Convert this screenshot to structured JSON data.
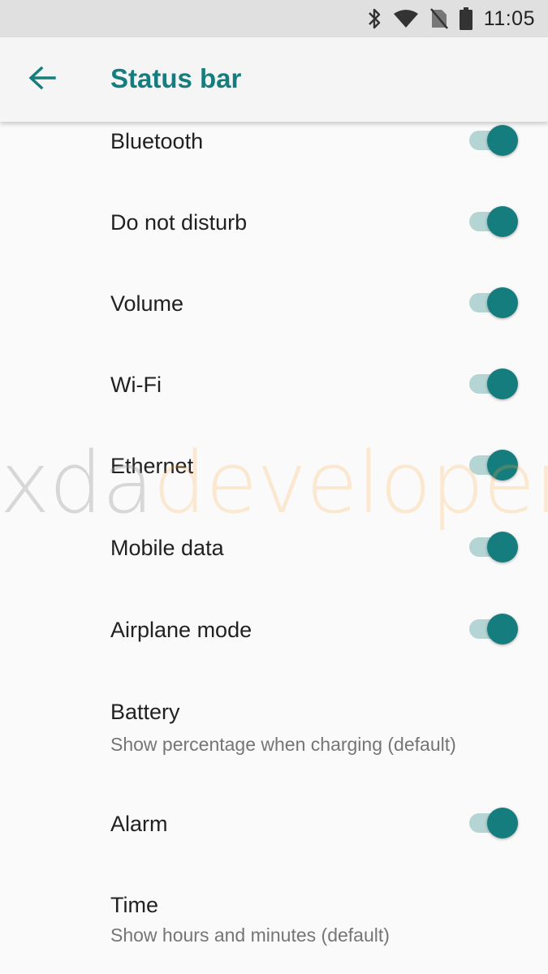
{
  "status_bar": {
    "time": "11:05",
    "icons": [
      "bluetooth-icon",
      "wifi-icon",
      "no-sim-icon",
      "battery-icon"
    ]
  },
  "app_bar": {
    "title": "Status bar",
    "back_icon": "arrow-back-icon"
  },
  "colors": {
    "accent": "#167d7f",
    "switch_track_on": "#b5d4d4",
    "background": "#fafafa",
    "status_bar_bg": "#e0e0e0"
  },
  "items": [
    {
      "title": "Bluetooth",
      "switch_on": true
    },
    {
      "title": "Do not disturb",
      "switch_on": true
    },
    {
      "title": "Volume",
      "switch_on": true
    },
    {
      "title": "Wi-Fi",
      "switch_on": true
    },
    {
      "title": "Ethernet",
      "switch_on": true
    },
    {
      "title": "Mobile data",
      "switch_on": true
    },
    {
      "title": "Airplane mode",
      "switch_on": true
    },
    {
      "title": "Battery",
      "subtitle": "Show percentage when charging (default)"
    },
    {
      "title": "Alarm",
      "switch_on": true
    },
    {
      "title": "Time",
      "subtitle": "Show hours and minutes (default)"
    }
  ],
  "watermark": {
    "part1": "xda",
    "part2": "developers"
  }
}
